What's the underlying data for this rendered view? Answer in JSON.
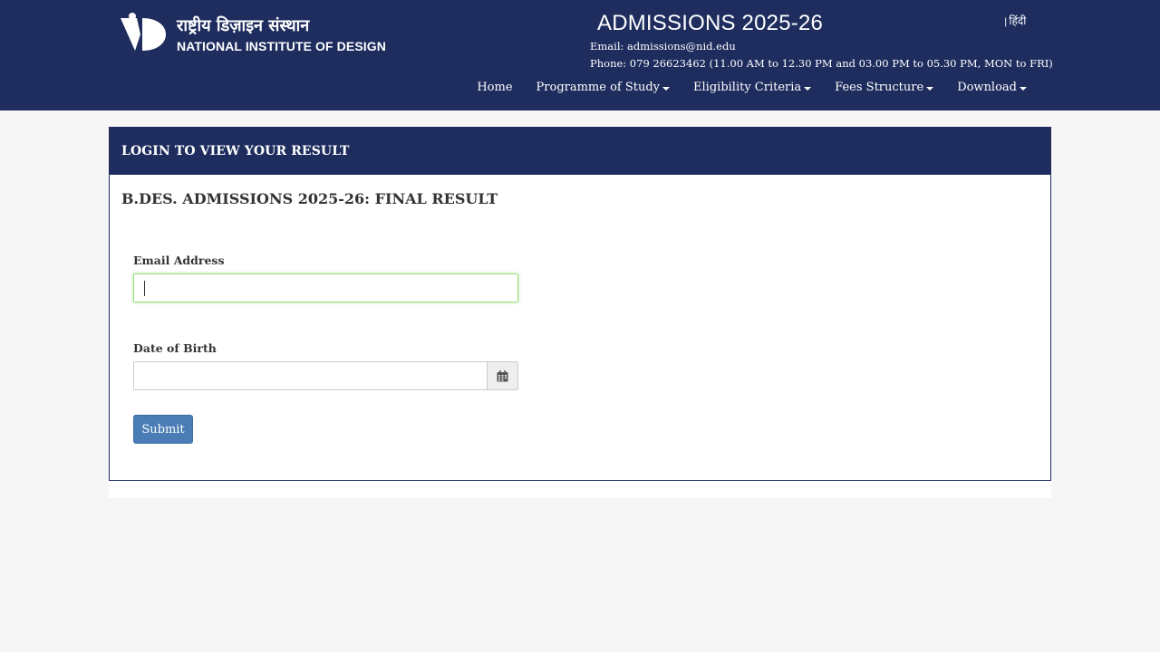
{
  "header": {
    "logo_hindi": "राष्ट्रीय डिज़ाइन संस्थान",
    "logo_english": "NATIONAL INSTITUTE OF DESIGN",
    "title": "ADMISSIONS 2025-26",
    "language_separator": "|",
    "language_link": "हिंदी",
    "email_line": "Email: admissions@nid.edu",
    "phone_line": "Phone: 079 26623462 (11.00 AM to 12.30 PM and 03.00 PM to 05.30 PM, MON to FRI)"
  },
  "nav": {
    "items": [
      {
        "label": "Home",
        "dropdown": false
      },
      {
        "label": "Programme of Study",
        "dropdown": true
      },
      {
        "label": "Eligibility Criteria",
        "dropdown": true
      },
      {
        "label": "Fees Structure",
        "dropdown": true
      },
      {
        "label": "Download",
        "dropdown": true
      }
    ]
  },
  "panel": {
    "heading": "LOGIN TO VIEW YOUR RESULT",
    "subtitle": "B.DES. ADMISSIONS 2025-26: FINAL RESULT",
    "email_label": "Email Address",
    "email_value": "",
    "dob_label": "Date of Birth",
    "dob_value": "",
    "calendar_icon": "calendar-icon",
    "submit_label": "Submit"
  },
  "colors": {
    "brand_navy": "#1e2d5e",
    "button_blue": "#4a7db5",
    "focus_green": "#9be07a"
  }
}
